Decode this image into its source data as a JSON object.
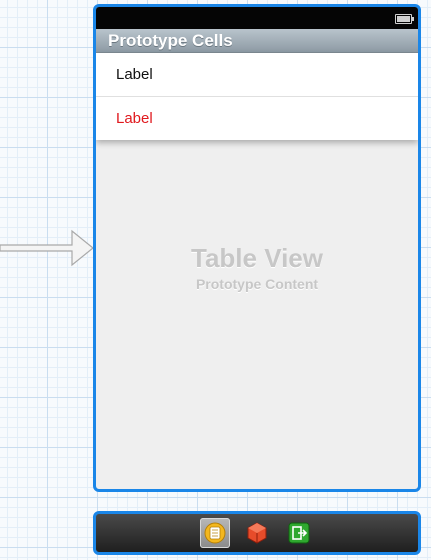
{
  "scene": {
    "section_header": "Prototype Cells",
    "cells": [
      {
        "label": "Label",
        "color": "#111111"
      },
      {
        "label": "Label",
        "color": "#e0191e"
      }
    ],
    "placeholder_title": "Table View",
    "placeholder_subtitle": "Prototype Content"
  },
  "dock": {
    "icons": [
      "view-controller-icon",
      "first-responder-icon",
      "exit-icon"
    ]
  },
  "colors": {
    "selection": "#1a86e8",
    "label_red": "#e0191e"
  }
}
